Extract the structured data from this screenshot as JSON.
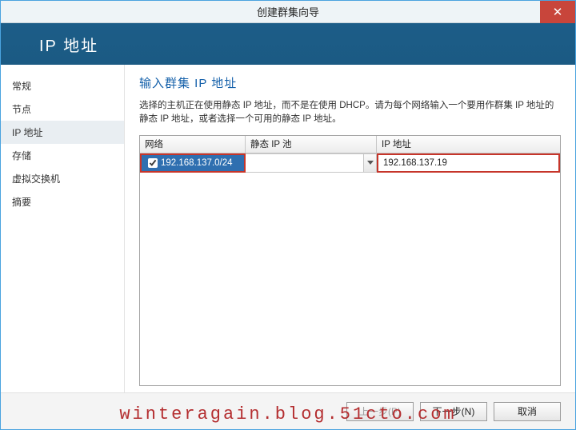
{
  "window": {
    "title": "创建群集向导"
  },
  "banner": {
    "title": "IP 地址"
  },
  "sidebar": {
    "items": [
      {
        "label": "常规"
      },
      {
        "label": "节点"
      },
      {
        "label": "IP 地址"
      },
      {
        "label": "存储"
      },
      {
        "label": "虚拟交换机"
      },
      {
        "label": "摘要"
      }
    ]
  },
  "section": {
    "heading": "输入群集 IP 地址",
    "description": "选择的主机正在使用静态 IP 地址，而不是在使用 DHCP。请为每个网络输入一个要用作群集 IP 地址的静态 IP 地址，或者选择一个可用的静态 IP 地址。"
  },
  "table": {
    "headers": {
      "network": "网络",
      "pool": "静态 IP 池",
      "ip": "IP 地址"
    },
    "rows": [
      {
        "checked": true,
        "network": "192.168.137.0/24",
        "pool": "",
        "ip": "192.168.137.19"
      }
    ]
  },
  "buttons": {
    "prev": "上一步(P)",
    "next": "下一步(N)",
    "cancel": "取消"
  },
  "watermark": "winteragain.blog.51cto.com"
}
